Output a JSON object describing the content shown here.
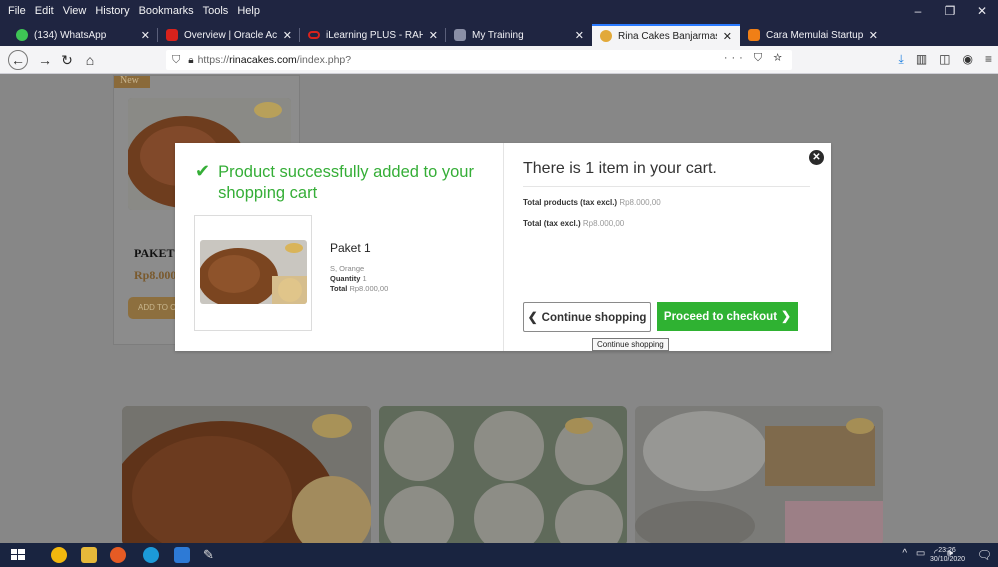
{
  "browser": {
    "menus": [
      "File",
      "Edit",
      "View",
      "History",
      "Bookmarks",
      "Tools",
      "Help"
    ],
    "tabs": [
      {
        "label": "(134) WhatsApp",
        "color": "#3ec455",
        "active": false
      },
      {
        "label": "Overview | Oracle Academy",
        "color": "#d9221c",
        "active": false
      },
      {
        "label": "iLearning PLUS - RAHIMI_FITRI",
        "color": "#d9221c",
        "active": false
      },
      {
        "label": "My Training",
        "color": "#8a8fa6",
        "active": false
      },
      {
        "label": "Rina Cakes Banjarmasin",
        "color": "#e2a93a",
        "active": true
      },
      {
        "label": "Cara Memulai Startup di Masa",
        "color": "#f07f16",
        "active": false
      }
    ],
    "url_prefix": "https://",
    "url_domain": "rinacakes.com",
    "url_path": "/index.php?",
    "url_right_icons": "··· ⛉ ☆"
  },
  "product_card": {
    "new_label": "New",
    "name": "PAKET 1",
    "price": "Rp8.000",
    "add_label": "ADD TO C"
  },
  "modal": {
    "success_message": "Product successfully added to your shopping cart",
    "product_name": "Paket 1",
    "attribute": "S, Orange",
    "quantity_label": "Quantity",
    "quantity_value": "1",
    "total_label": "Total",
    "total_value": "Rp8.000,00",
    "cart_title": "There is 1 item in your cart.",
    "total_products_label": "Total products (tax excl.)",
    "total_products_value": "Rp8.000,00",
    "total_tax_label": "Total (tax excl.)",
    "total_tax_value": "Rp8.000,00",
    "continue_label": "Continue shopping",
    "checkout_label": "Proceed to checkout",
    "tooltip": "Continue shopping"
  },
  "taskbar": {
    "time": "23:26",
    "date": "30/10/2020"
  }
}
